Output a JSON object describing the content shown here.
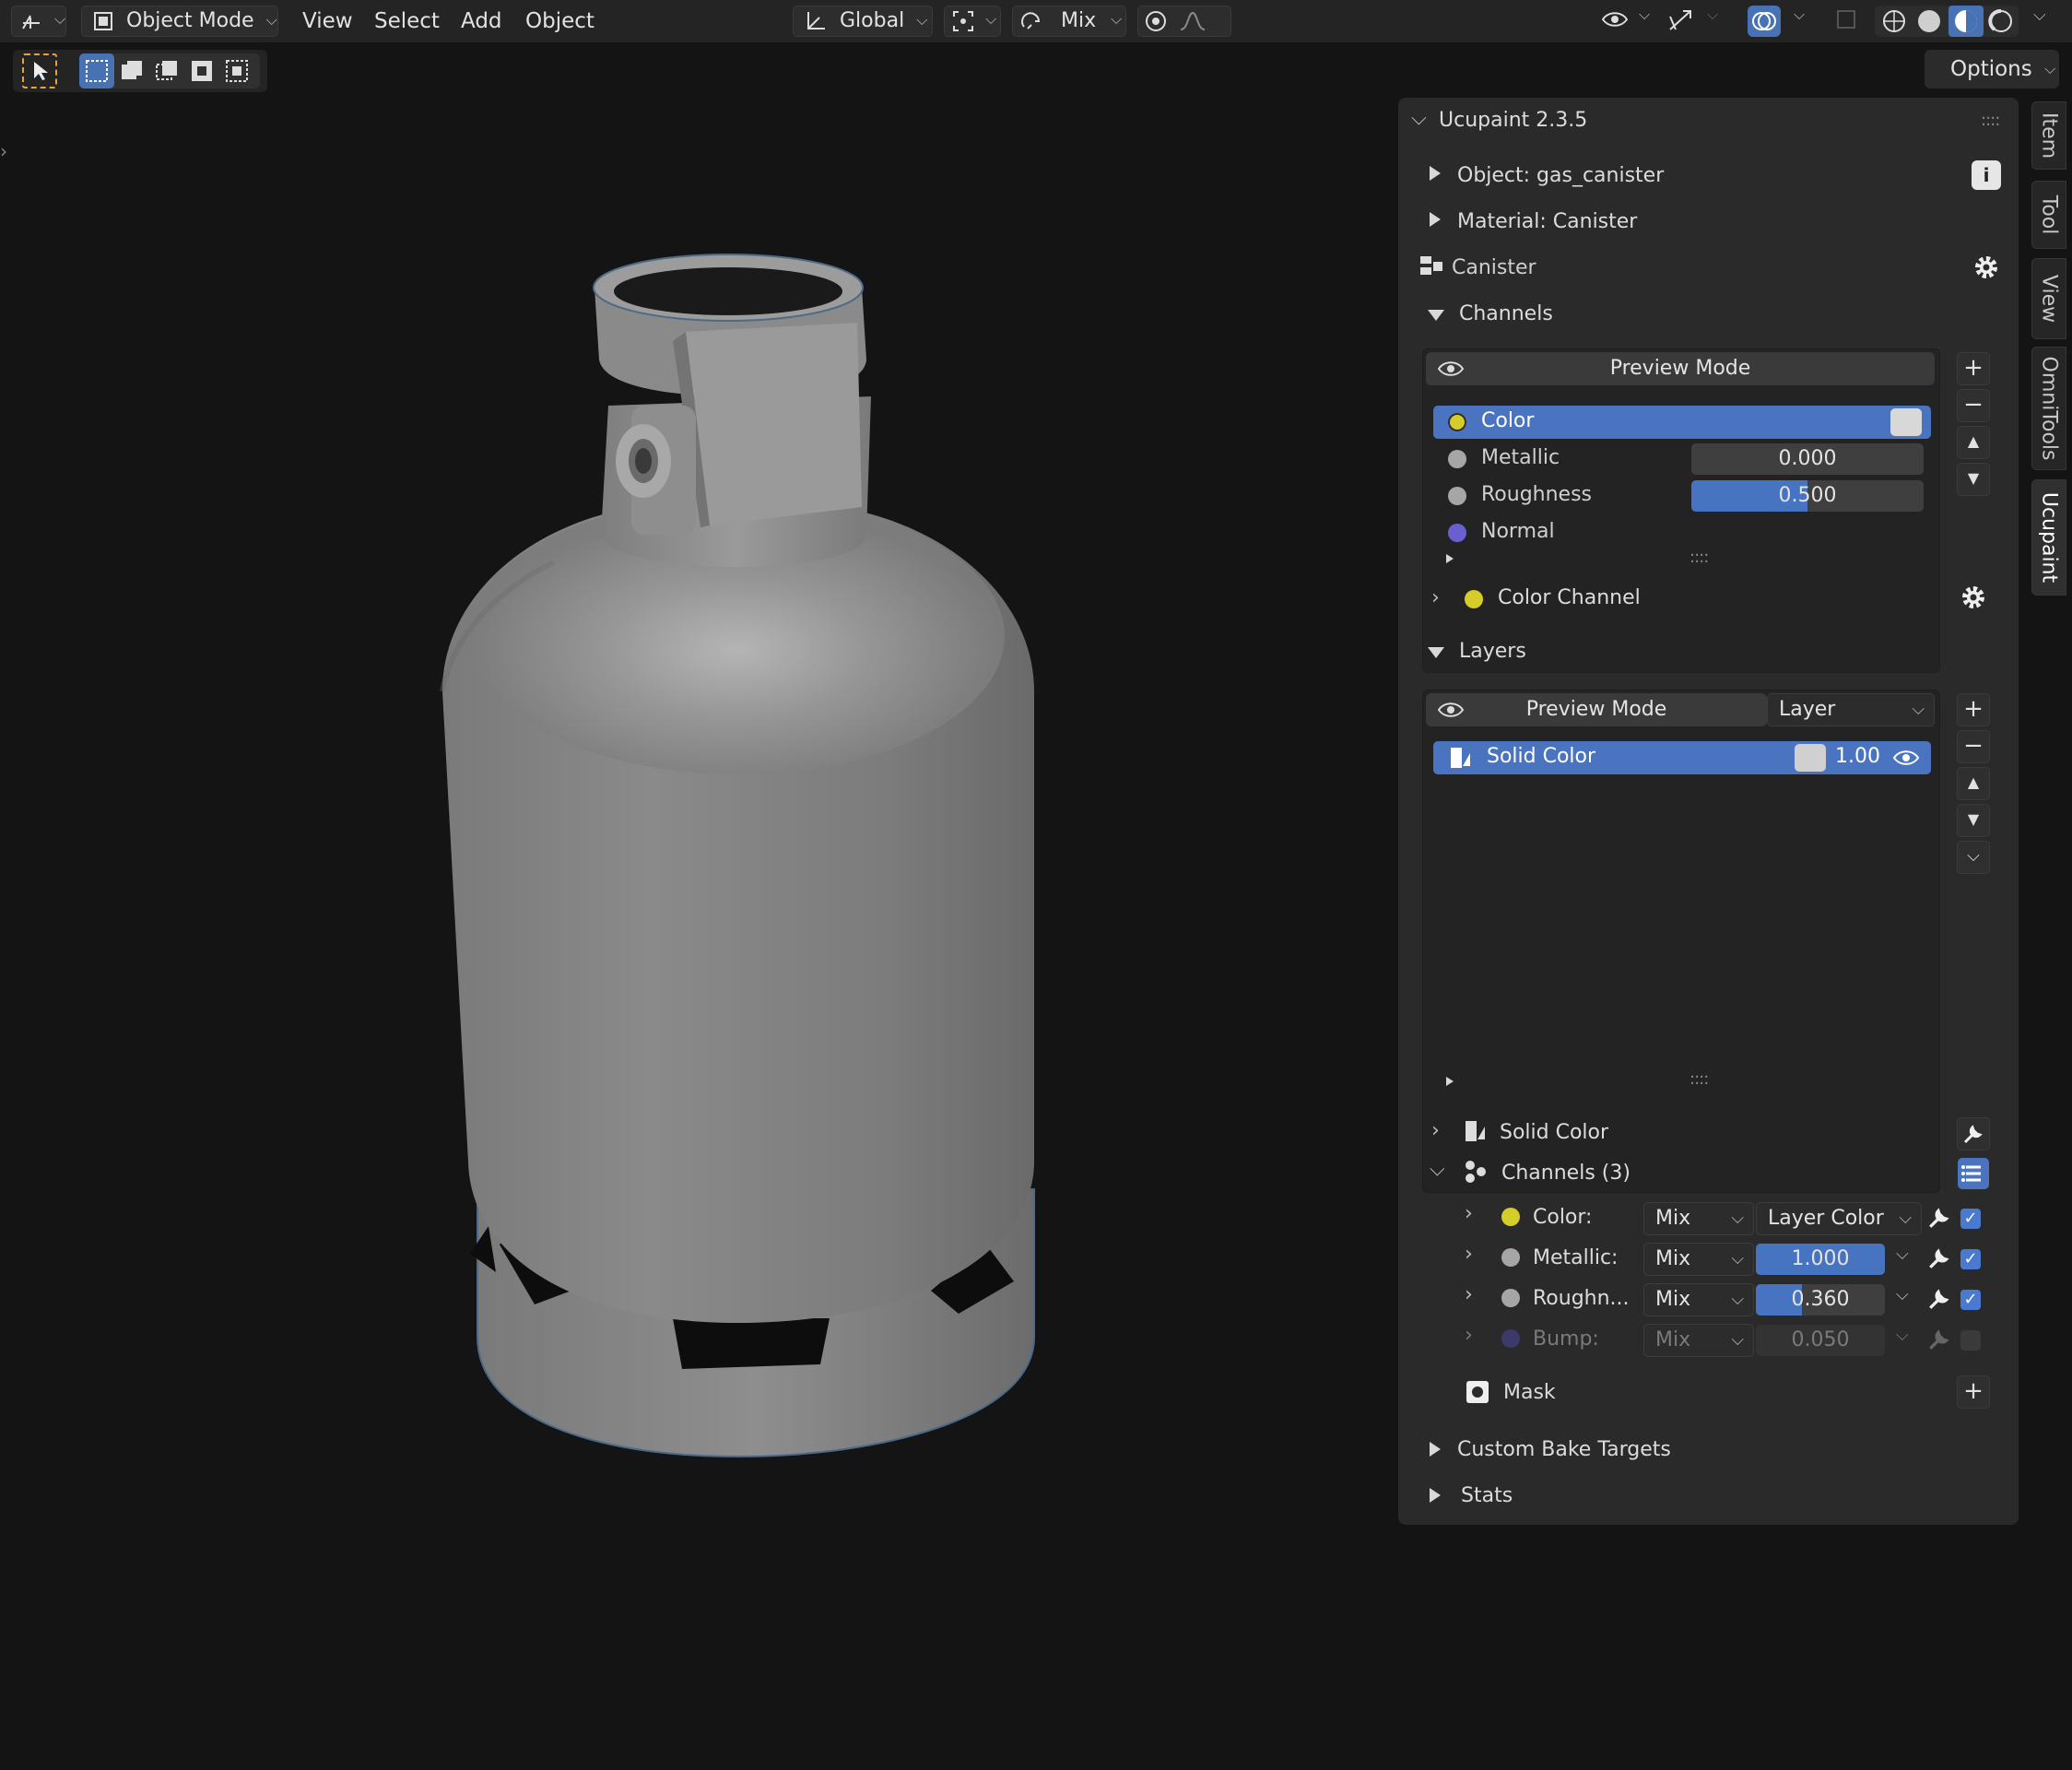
{
  "header": {
    "mode": "Object Mode",
    "menus": [
      "View",
      "Select",
      "Add",
      "Object"
    ],
    "orientation": "Global",
    "snap_blend": "Mix"
  },
  "toolbar": {
    "options_label": "Options"
  },
  "side_tabs": [
    "Item",
    "Tool",
    "View",
    "OmniTools",
    "Ucupaint"
  ],
  "panel": {
    "title": "Ucupaint 2.3.5",
    "object_label": "Object: gas_canister",
    "material_label": "Material: Canister",
    "node_name": "Canister",
    "channels_header": "Channels",
    "channels_preview_mode": "Preview Mode",
    "channels": [
      {
        "name": "Color",
        "color": "#d6cc2a",
        "value": "",
        "fill": 0
      },
      {
        "name": "Metallic",
        "color": "#a6a6a6",
        "value": "0.000",
        "fill": 0.0
      },
      {
        "name": "Roughness",
        "color": "#a6a6a6",
        "value": "0.500",
        "fill": 0.5
      },
      {
        "name": "Normal",
        "color": "#6a5fd0",
        "value": "",
        "fill": 0
      }
    ],
    "color_channel_label": "Color Channel",
    "layers_header": "Layers",
    "layers_preview_mode": "Preview Mode",
    "layers_dropdown": "Layer",
    "layers": [
      {
        "name": "Solid Color",
        "opacity": "1.00"
      }
    ],
    "layer_detail_label": "Solid Color",
    "layer_channels_label": "Channels (3)",
    "layer_channels": [
      {
        "label": "Color:",
        "color": "#d6cc2a",
        "blend": "Mix",
        "value": "Layer Color",
        "is_dropdown": true,
        "fill": 0,
        "enabled": true
      },
      {
        "label": "Metallic:",
        "color": "#a6a6a6",
        "blend": "Mix",
        "value": "1.000",
        "is_dropdown": false,
        "fill": 1.0,
        "enabled": true
      },
      {
        "label": "Roughn...",
        "color": "#a6a6a6",
        "blend": "Mix",
        "value": "0.360",
        "is_dropdown": false,
        "fill": 0.36,
        "enabled": true
      },
      {
        "label": "Bump:",
        "color": "#3d3a6a",
        "blend": "Mix",
        "value": "0.050",
        "is_dropdown": false,
        "fill": 0,
        "enabled": false
      }
    ],
    "mask_label": "Mask",
    "custom_bake_label": "Custom Bake Targets",
    "stats_label": "Stats"
  }
}
